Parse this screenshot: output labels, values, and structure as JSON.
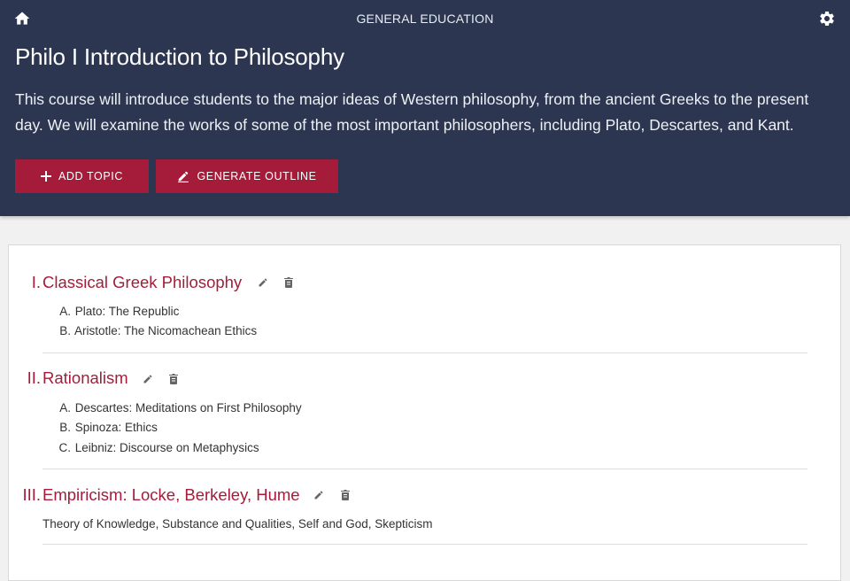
{
  "topbar": {
    "title": "GENERAL EDUCATION",
    "home_icon": "home-icon",
    "settings_icon": "gear-icon"
  },
  "course": {
    "title": "Philo I Introduction to Philosophy",
    "description": "This course will introduce students to the major ideas of Western philosophy, from the ancient Greeks to the present day. We will examine the works of some of the most important philosophers, including Plato, Descartes, and Kant."
  },
  "actions": {
    "add_topic": "ADD TOPIC",
    "generate_outline": "GENERATE OUTLINE"
  },
  "colors": {
    "header_bg": "#2c3650",
    "accent": "#a51c3a"
  },
  "topics": [
    {
      "num": "I.",
      "title": "Classical Greek Philosophy",
      "items": [
        {
          "letter": "A.",
          "text": "Plato: The Republic"
        },
        {
          "letter": "B.",
          "text": "Aristotle: The Nicomachean Ethics"
        }
      ]
    },
    {
      "num": "II.",
      "title": "Rationalism",
      "items": [
        {
          "letter": "A.",
          "text": "Descartes: Meditations on First Philosophy"
        },
        {
          "letter": "B.",
          "text": "Spinoza: Ethics"
        },
        {
          "letter": "C.",
          "text": "Leibniz: Discourse on Metaphysics"
        }
      ]
    },
    {
      "num": "III.",
      "title": "Empiricism: Locke, Berkeley, Hume",
      "description": "Theory of Knowledge, Substance and Qualities, Self and God, Skepticism"
    }
  ]
}
